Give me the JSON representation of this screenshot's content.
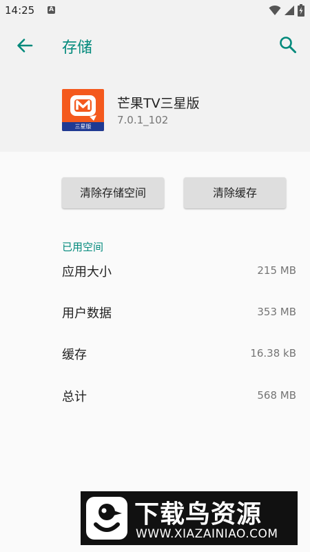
{
  "status_bar": {
    "time": "14:25",
    "notification_glyph": "A",
    "icons": [
      "wifi-icon",
      "signal-icon",
      "battery-icon"
    ]
  },
  "header": {
    "title": "存储",
    "back_icon": "arrow-left-icon",
    "search_icon": "search-icon"
  },
  "app": {
    "name": "芒果TV三星版",
    "version": "7.0.1_102",
    "icon_badge_text": "三星版",
    "icon_brand_color": "#f4591d"
  },
  "buttons": {
    "clear_storage": "清除存储空间",
    "clear_cache": "清除缓存"
  },
  "storage": {
    "section_label": "已用空间",
    "rows": [
      {
        "label": "应用大小",
        "value": "215 MB"
      },
      {
        "label": "用户数据",
        "value": "353 MB"
      },
      {
        "label": "缓存",
        "value": "16.38 kB"
      },
      {
        "label": "总计",
        "value": "568 MB"
      }
    ]
  },
  "watermark": {
    "title": "下载鸟资源",
    "url": "WWW.XIAZAINIAO.COM"
  },
  "colors": {
    "accent": "#00897b",
    "header_bg": "#f2f2f2",
    "page_bg": "#fafafa"
  }
}
